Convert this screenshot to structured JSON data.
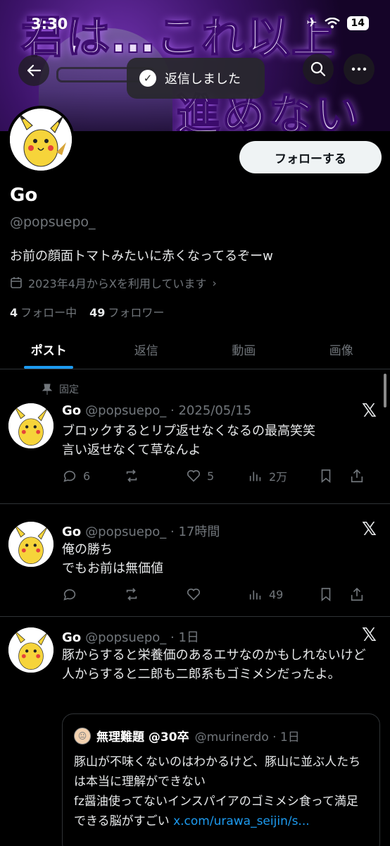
{
  "status_bar": {
    "time": "3:30",
    "battery": "14"
  },
  "toast": {
    "text": "返信しました"
  },
  "profile": {
    "follow_label": "フォローする",
    "name": "Go",
    "handle": "@popsuepo_",
    "bio": "お前の顔面トマトみたいに赤くなってるぞーw",
    "joined": "2023年4月からXを利用しています",
    "following_count": "4",
    "following_label": "フォロー中",
    "followers_count": "49",
    "followers_label": "フォロワー"
  },
  "tabs": [
    {
      "label": "ポスト",
      "active": true
    },
    {
      "label": "返信"
    },
    {
      "label": "動画"
    },
    {
      "label": "画像"
    }
  ],
  "posts": [
    {
      "pinned_label": "固定",
      "name": "Go",
      "handle_time": "@popsuepo_ · 2025/05/15",
      "body": "ブロックするとリプ返せなくなるの最高笑笑\n言い返せなくて草なんよ",
      "replies": "6",
      "reposts": "",
      "likes": "5",
      "views": "2万"
    },
    {
      "name": "Go",
      "handle_time": "@popsuepo_ · 17時間",
      "body": "俺の勝ち\nでもお前は無価値",
      "replies": "",
      "reposts": "",
      "likes": "",
      "views": "49"
    },
    {
      "name": "Go",
      "handle_time": "@popsuepo_ · 1日",
      "body": "豚からすると栄養価のあるエサなのかもしれないけど\n人からすると二郎も二郎系もゴミメシだったよ。",
      "quote": {
        "name": "無理難題 @30卒",
        "handle_time": "@murinerdo · 1日",
        "body": "豚山が不味くないのはわかるけど、豚山に並ぶ人たちは本当に理解ができない\nfz醤油使ってないインスパイアのゴミメシ食って満足できる脳がすごい ",
        "link": "x.com/urawa_seijin/s..."
      }
    }
  ],
  "banner_text": [
    "君は…これ以上",
    "進めない"
  ]
}
